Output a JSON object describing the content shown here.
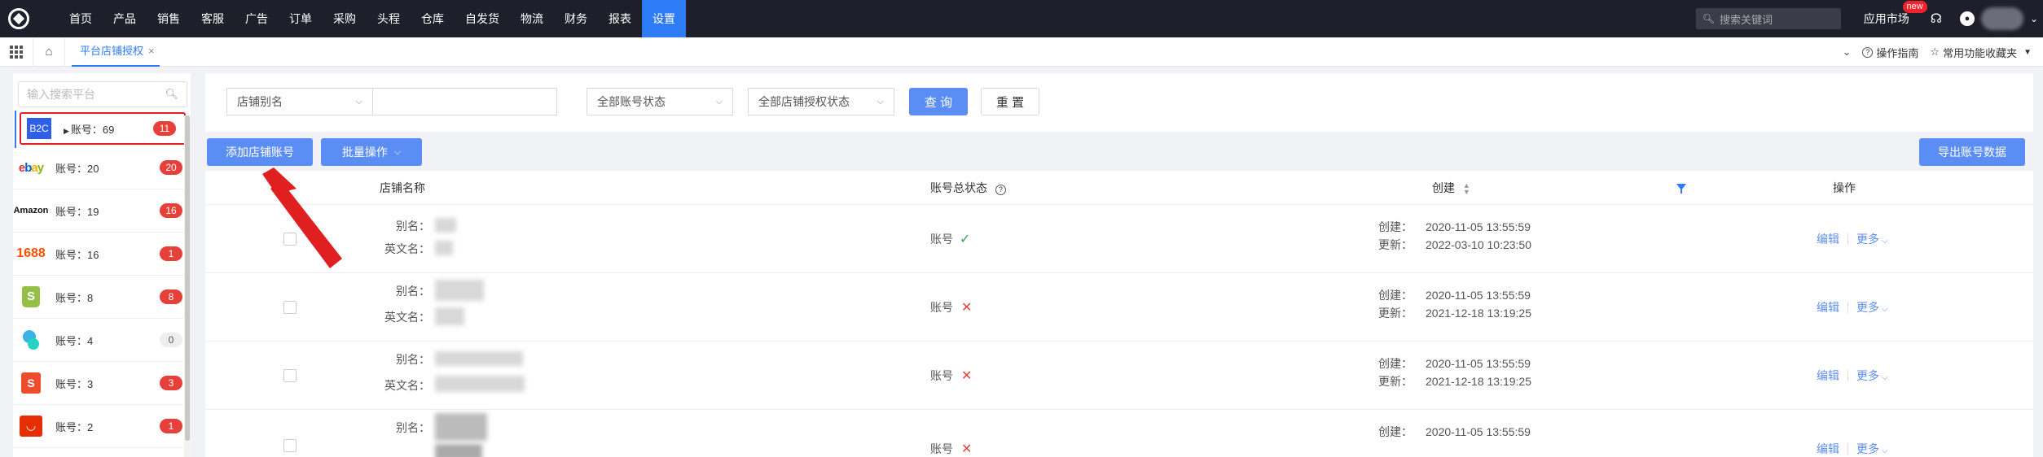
{
  "nav": {
    "items": [
      "首页",
      "产品",
      "销售",
      "客服",
      "广告",
      "订单",
      "采购",
      "头程",
      "仓库",
      "自发货",
      "物流",
      "财务",
      "报表",
      "设置"
    ],
    "active_index": 13,
    "search_placeholder": "搜索关键词",
    "app_market": "应用市场",
    "new_badge": "new"
  },
  "tabbar": {
    "tab_label": "平台店铺授权",
    "close": "×",
    "guide": "操作指南",
    "favorites": "常用功能收藏夹"
  },
  "platform_list": {
    "search_placeholder": "输入搜索平台",
    "items": [
      {
        "logo": "B2C",
        "count": "账号：69",
        "badge": "11"
      },
      {
        "logo": "ebay",
        "count": "账号：20",
        "badge": "20"
      },
      {
        "logo": "Amazon",
        "count": "账号：19",
        "badge": "16"
      },
      {
        "logo": "1688",
        "count": "账号：16",
        "badge": "1"
      },
      {
        "logo": "shopify",
        "count": "账号：8",
        "badge": "8"
      },
      {
        "logo": "blob",
        "count": "账号：4",
        "badge": "0"
      },
      {
        "logo": "shopee",
        "count": "账号：3",
        "badge": "3"
      },
      {
        "logo": "aliexpress",
        "count": "账号：2",
        "badge": "1"
      }
    ]
  },
  "filters": {
    "store_alias_select": "店铺别名",
    "account_status_select": "全部账号状态",
    "auth_status_select": "全部店铺授权状态",
    "query_btn": "查 询",
    "reset_btn": "重 置"
  },
  "actions": {
    "add_account": "添加店铺账号",
    "batch": "批量操作",
    "export": "导出账号数据"
  },
  "table": {
    "headers": {
      "store_name": "店铺名称",
      "account_status": "账号总状态",
      "created": "创建",
      "operations": "操作"
    },
    "rows": [
      {
        "alias_label": "别名：",
        "en_label": "英文名：",
        "status": "账号",
        "status_ok": true,
        "created_label": "创建：",
        "created": "2020-11-05 13:55:59",
        "updated_label": "更新：",
        "updated": "2022-03-10 10:23:50",
        "edit": "编辑",
        "more": "更多"
      },
      {
        "alias_label": "别名：",
        "en_label": "英文名：",
        "status": "账号",
        "status_ok": false,
        "created_label": "创建：",
        "created": "2020-11-05 13:55:59",
        "updated_label": "更新：",
        "updated": "2021-12-18 13:19:25",
        "edit": "编辑",
        "more": "更多"
      },
      {
        "alias_label": "别名：",
        "en_label": "英文名：",
        "status": "账号",
        "status_ok": false,
        "created_label": "创建：",
        "created": "2020-11-05 13:55:59",
        "updated_label": "更新：",
        "updated": "2021-12-18 13:19:25",
        "edit": "编辑",
        "more": "更多"
      },
      {
        "alias_label": "别名：",
        "en_label": "",
        "status": "账号",
        "status_ok": false,
        "created_label": "创建：",
        "created": "2020-11-05 13:55:59",
        "updated_label": "",
        "updated": "",
        "edit": "编辑",
        "more": "更多"
      }
    ]
  },
  "icons": {
    "check": "✓",
    "cross": "✕"
  },
  "colors": {
    "primary": "#5b8ef5",
    "nav_bg": "#1e1f2b",
    "danger": "#e5403a",
    "annotation": "#e02020"
  }
}
